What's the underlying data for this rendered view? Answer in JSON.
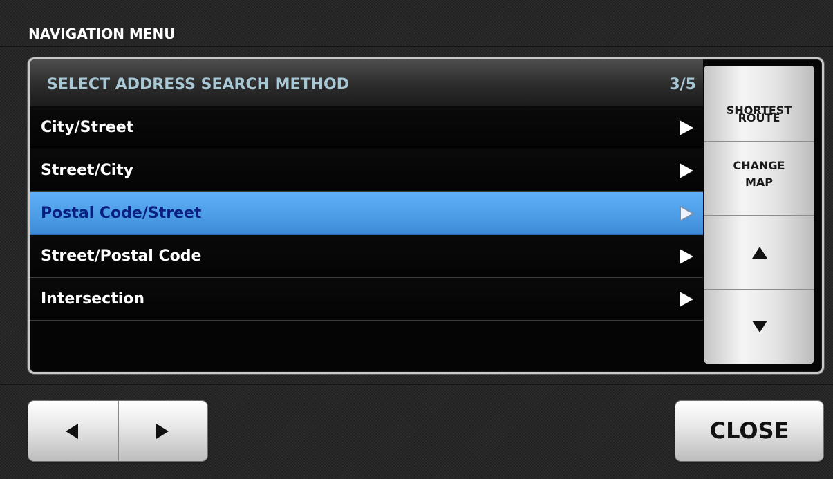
{
  "screen": {
    "title": "NAVIGATION MENU"
  },
  "list": {
    "header_title": "SELECT ADDRESS SEARCH METHOD",
    "page_indicator": "3/5",
    "items": [
      {
        "label": "City/Street",
        "selected": false
      },
      {
        "label": "Street/City",
        "selected": false
      },
      {
        "label": "Postal Code/Street",
        "selected": true
      },
      {
        "label": "Street/Postal Code",
        "selected": false
      },
      {
        "label": "Intersection",
        "selected": false
      }
    ]
  },
  "side_buttons": {
    "shortest_route": {
      "line1": "SHORTEST",
      "line2": "ROUTE"
    },
    "change_map": {
      "line1": "CHANGE",
      "line2": "MAP"
    },
    "scroll_up_icon": "triangle-up-icon",
    "scroll_down_icon": "triangle-down-icon"
  },
  "footer": {
    "prev_icon": "triangle-left-icon",
    "next_icon": "triangle-right-icon",
    "close_label": "CLOSE"
  },
  "colors": {
    "header_text": "#a9c8d6",
    "selected_row": "#4f9fe8",
    "selected_text": "#0b1f83",
    "list_background": "#050505"
  }
}
